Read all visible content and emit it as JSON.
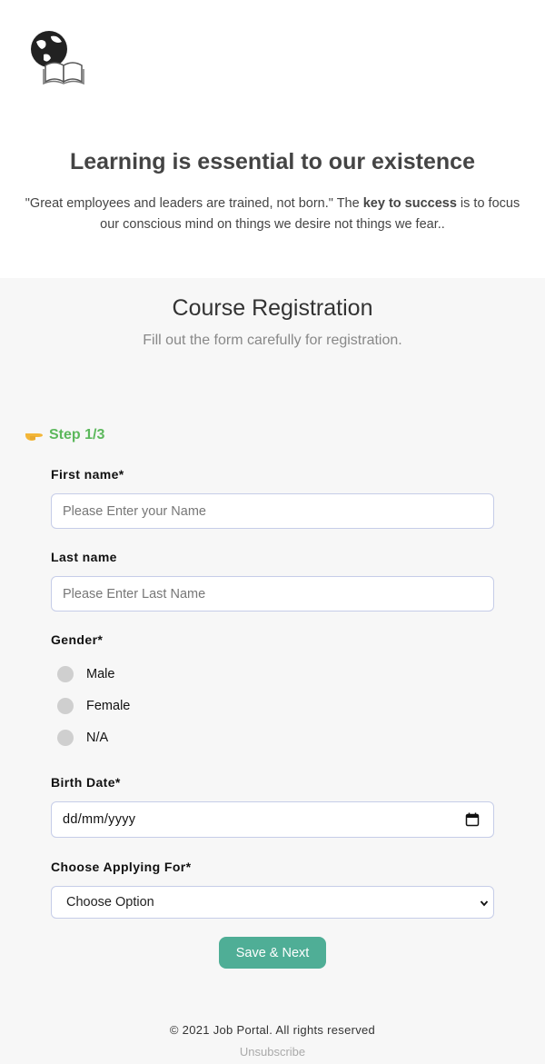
{
  "header": {
    "logo_icon": "globe-book-icon",
    "title": "Learning is essential to our existence",
    "quote_prefix": "\"Great employees and leaders are trained, not born.\" The ",
    "quote_bold": "key to success",
    "quote_suffix": " is to focus our conscious mind on things we desire not things we fear.."
  },
  "form": {
    "title": "Course Registration",
    "subtitle": "Fill out the form carefully for registration.",
    "step": {
      "icon": "pointing-hand-icon",
      "label": "Step 1/3"
    },
    "first_name": {
      "label": "First name*",
      "placeholder": "Please Enter your Name"
    },
    "last_name": {
      "label": "Last name",
      "placeholder": "Please Enter Last Name"
    },
    "gender": {
      "label": "Gender*",
      "options": [
        "Male",
        "Female",
        "N/A"
      ]
    },
    "birth_date": {
      "label": "Birth Date*",
      "value": "dd/mm/yyyy",
      "icon": "calendar-icon"
    },
    "applying_for": {
      "label": "Choose Applying For*",
      "selected": "Choose Option",
      "icon": "chevron-down-icon"
    },
    "submit_label": "Save & Next"
  },
  "footer": {
    "copyright": "© 2021 Job Portal. All rights reserved",
    "unsubscribe": "Unsubscribe"
  },
  "colors": {
    "accent_green": "#5cb85c",
    "button": "#4fae96",
    "panel_bg": "#f7f7f7"
  }
}
